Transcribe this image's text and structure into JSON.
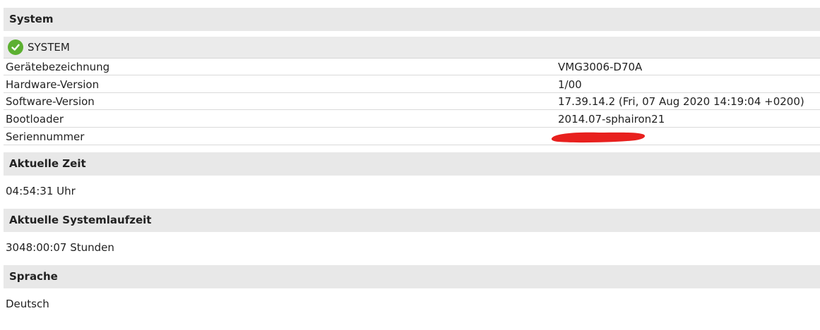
{
  "sections": {
    "system": {
      "title": "System"
    },
    "time": {
      "title": "Aktuelle Zeit",
      "value": "04:54:31 Uhr"
    },
    "uptime": {
      "title": "Aktuelle Systemlaufzeit",
      "value": "3048:00:07 Stunden"
    },
    "language": {
      "title": "Sprache",
      "value": "Deutsch"
    }
  },
  "system_block": {
    "status_icon": "check-circle-icon",
    "status_color": "#5cb031",
    "label": "SYSTEM",
    "rows": [
      {
        "label": "Gerätebezeichnung",
        "value": "VMG3006-D70A"
      },
      {
        "label": "Hardware-Version",
        "value": "1/00"
      },
      {
        "label": "Software-Version",
        "value": "17.39.14.2 (Fri, 07 Aug 2020 14:19:04 +0200)"
      },
      {
        "label": "Bootloader",
        "value": "2014.07-sphairon21"
      },
      {
        "label": "Seriennummer",
        "value": ""
      }
    ]
  },
  "redaction_color": "#e8201e"
}
